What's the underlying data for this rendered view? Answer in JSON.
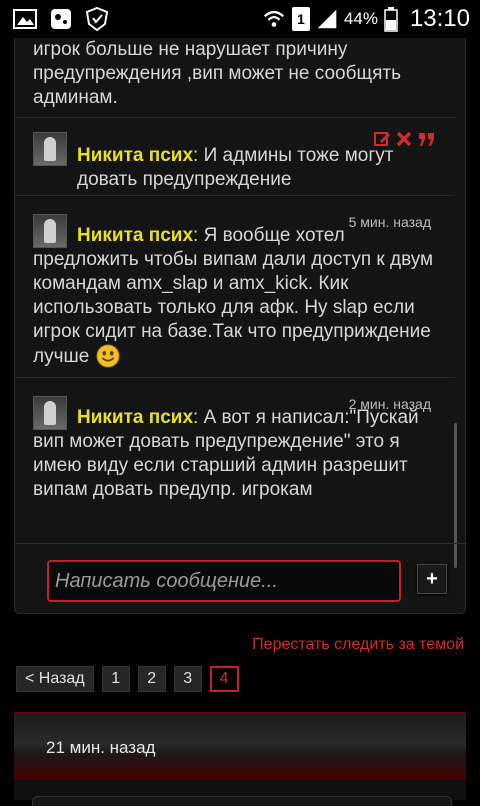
{
  "status_bar": {
    "battery_percent": "44%",
    "clock": "13:10",
    "sim_slot": "1"
  },
  "messages": [
    {
      "text": "игрок больше не нарушает причину предупреждения ,вип может не сообщять админам."
    },
    {
      "author": "Никита псих",
      "text": ": И админы тоже могут довать предупреждение"
    },
    {
      "author": "Никита псих",
      "time": "5 мин. назад",
      "text": ": Я вообще хотел предложить чтобы випам дали доступ к двум командам amx_slap и amx_kick. Кик использовать только для афк. Ну slap если игрок сидит на базе.Так что предуприждение лучше"
    },
    {
      "author": "Никита псих",
      "time": "2 мин. назад",
      "text": ": А вот я написал:\"Пускай вип может довать предупреждение\" это я имею виду если старший админ разрешит випам довать предупр. игрокам"
    }
  ],
  "compose": {
    "placeholder": "Написать сообщение...",
    "send_label": "+"
  },
  "unfollow_label": "Перестать следить за темой",
  "pager": {
    "back_label": "< Назад",
    "pages": [
      "1",
      "2",
      "3",
      "4"
    ],
    "current": "4"
  },
  "next_block": {
    "time": "21 мин. назад"
  },
  "colors": {
    "accent_red": "#c62020",
    "author_yellow": "#e8e020"
  }
}
